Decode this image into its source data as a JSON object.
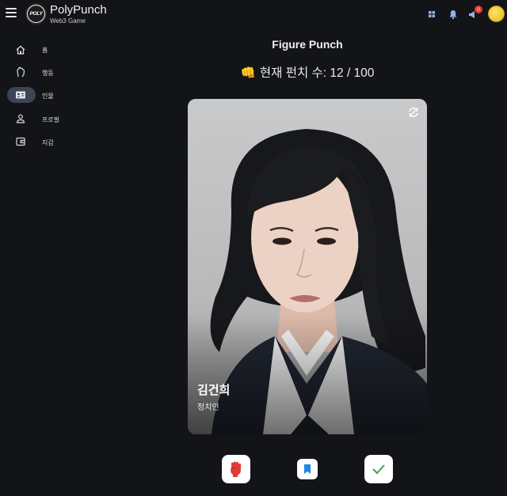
{
  "header": {
    "brand_name": "PolyPunch",
    "brand_sub": "Web3 Game",
    "logo_text": "POLY",
    "notification_badge": "0"
  },
  "sidebar": {
    "items": [
      {
        "label": "홈",
        "icon": "home-icon"
      },
      {
        "label": "행동",
        "icon": "hand-icon"
      },
      {
        "label": "인물",
        "icon": "id-card-icon"
      },
      {
        "label": "프로필",
        "icon": "person-icon"
      },
      {
        "label": "지갑",
        "icon": "wallet-icon"
      }
    ],
    "active_index": 2
  },
  "main": {
    "title": "Figure Punch",
    "punch_count_label": "현재 펀치 수: 12 / 100",
    "fist_emoji": "👊"
  },
  "card": {
    "name": "김건희",
    "role": "정치인"
  },
  "actions": {
    "punch_icon": "fist-icon",
    "bookmark_icon": "bookmark-icon",
    "confirm_icon": "check-icon"
  },
  "colors": {
    "background": "#121418",
    "active_nav": "#3b4557",
    "punch_red": "#e53935",
    "bookmark_blue": "#1e88e5",
    "check_green": "#43a047",
    "avatar_gold": "#f2c94c"
  }
}
